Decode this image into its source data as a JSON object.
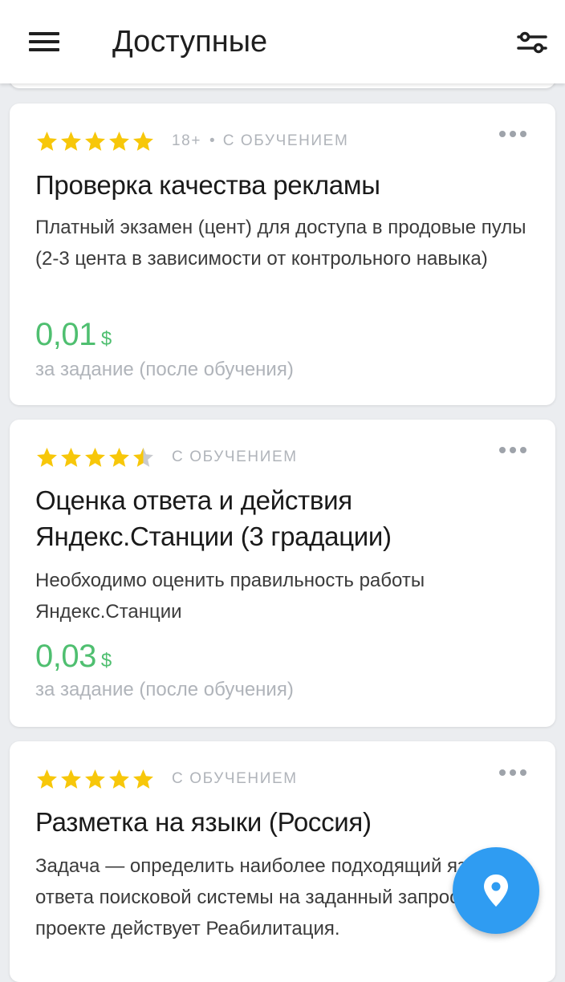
{
  "header": {
    "title": "Доступные",
    "menu_icon": "hamburger-menu-icon",
    "filter_icon": "sliders-filter-icon"
  },
  "colors": {
    "star_filled": "#f7c70a",
    "star_empty": "#c9cbcf",
    "price": "#4fbf70",
    "fab": "#2f9cf2"
  },
  "tasks": [
    {
      "rating": 5,
      "age": "18+",
      "tag": "С ОБУЧЕНИЕМ",
      "title": "Проверка качества рекламы",
      "description": "Платный экзамен (цент) для доступа в продовые пулы (2-3 цента в зависимости от контрольного навыка)",
      "price": "0,01",
      "currency": "$",
      "price_note": "за задание (после обучения)"
    },
    {
      "rating": 4.5,
      "tag": "С ОБУЧЕНИЕМ",
      "title": "Оценка ответа и действия Яндекс.Станции (3 градации)",
      "description": "Необходимо оценить правильность работы Яндекс.Станции",
      "price": "0,03",
      "currency": "$",
      "price_note": "за задание (после обучения)"
    },
    {
      "rating": 5,
      "tag": "С ОБУЧЕНИЕМ",
      "title": "Разметка на языки (Россия)",
      "description": "Задача — определить наиболее подходящий язык ответа поисковой системы на заданный запрос. В проекте действует Реабилитация."
    }
  ],
  "fab": {
    "icon": "map-pin-icon"
  }
}
